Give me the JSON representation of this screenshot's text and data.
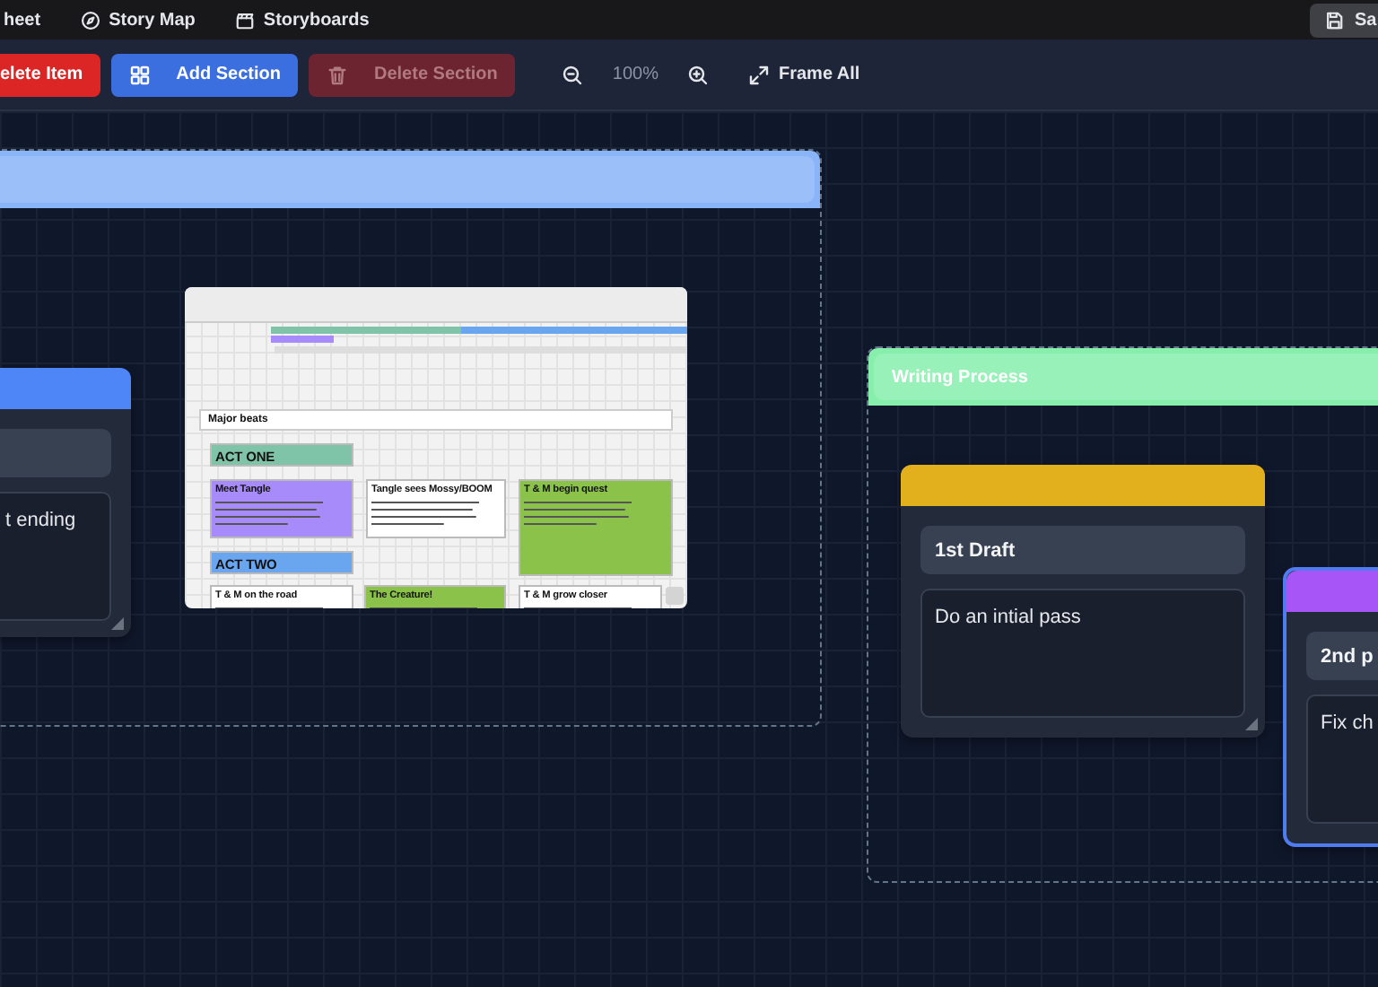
{
  "nav": {
    "tabs": [
      {
        "label": "heet"
      },
      {
        "label": "Story Map"
      },
      {
        "label": "Storyboards"
      }
    ],
    "save_button": "Sa"
  },
  "toolbar": {
    "buttons": [
      {
        "label": "elete Item",
        "kind": "danger",
        "disabled": false
      },
      {
        "label": "Add Section",
        "kind": "primary",
        "disabled": false
      },
      {
        "label": "Delete Section",
        "kind": "danger",
        "disabled": true
      }
    ],
    "zoom": "100%",
    "frame_all": "Frame All"
  },
  "canvas": {
    "sections": [
      {
        "color": "#8ab4f8"
      },
      {
        "title": "Writing Process",
        "color": "#86efac"
      }
    ],
    "cards": [
      {
        "color": "#4f86f7",
        "body": "t ending",
        "selected": false
      },
      {
        "color": "#e1b01c",
        "title": "1st Draft",
        "body": "Do an intial pass",
        "selected": false
      },
      {
        "color": "#a855f7",
        "title": "2nd p",
        "body": "Fix ch",
        "selected": true
      }
    ],
    "screenshot": {
      "heading": "Major beats",
      "cards": [
        {
          "kind": "act",
          "title": "ACT ONE",
          "color": "#7fc4a8"
        },
        {
          "kind": "beat",
          "title": "Meet Tangle",
          "color": "#a78bfa"
        },
        {
          "kind": "beat",
          "title": "Tangle sees Mossy/BOOM",
          "color": "#ffffff"
        },
        {
          "kind": "beat",
          "title": "T & M begin quest",
          "color": "#8bc34a"
        },
        {
          "kind": "act",
          "title": "ACT TWO",
          "color": "#6aa6f0"
        },
        {
          "kind": "beat",
          "title": "T & M on the road",
          "color": "#ffffff"
        },
        {
          "kind": "beat",
          "title": "The Creature!",
          "color": "#8bc34a"
        },
        {
          "kind": "beat",
          "title": "T & M grow closer",
          "color": "#ffffff"
        }
      ]
    }
  }
}
